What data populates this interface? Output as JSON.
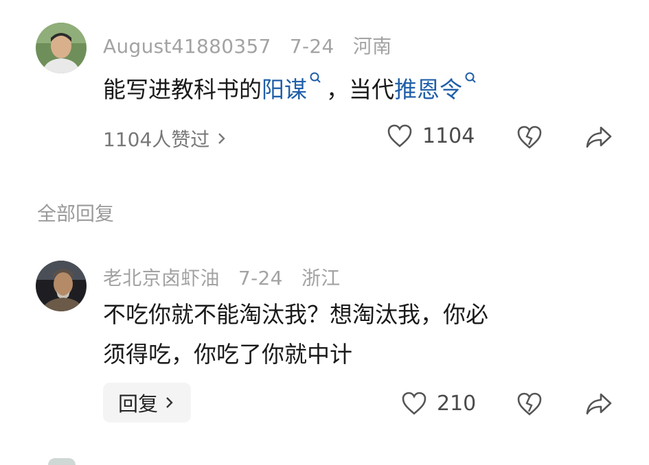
{
  "comment": {
    "username": "August41880357",
    "date": "7-24",
    "location": "河南",
    "text_plain_1": "能写进教科书的",
    "link_1": "阳谋",
    "text_plain_2": "，当代",
    "link_2": "推恩令",
    "liked_by": "1104人赞过",
    "like_count": "1104"
  },
  "section": {
    "title": "全部回复"
  },
  "reply": {
    "username": "老北京卤虾油",
    "date": "7-24",
    "location": "浙江",
    "line_1": "不吃你就不能淘汰我？想淘汰我，你必",
    "line_2": "须得吃，你吃了你就中计",
    "reply_label": "回复",
    "like_count": "210"
  },
  "icons": {
    "like": "heart-outline-icon",
    "dislike": "broken-heart-icon",
    "share": "share-arrow-icon",
    "search_link": "magnifier-icon"
  },
  "colors": {
    "link": "#1f5fa8",
    "meta": "#a3a3a3",
    "text": "#1a1a1a"
  }
}
